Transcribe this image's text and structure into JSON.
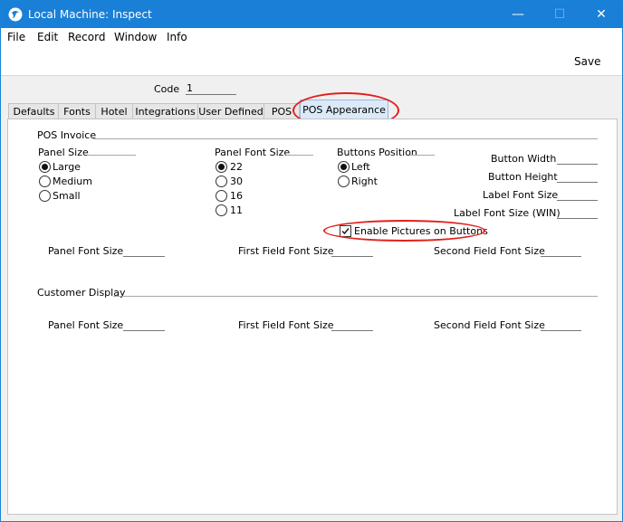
{
  "window": {
    "title": "Local Machine: Inspect",
    "minimize": "—",
    "maximize": "☐",
    "close": "✕"
  },
  "menu": [
    "File",
    "Edit",
    "Record",
    "Window",
    "Info"
  ],
  "toolbar": {
    "save_label": "Save"
  },
  "header": {
    "code_label": "Code",
    "code_value": "1"
  },
  "tabs": [
    "Defaults",
    "Fonts",
    "Hotel",
    "Integrations",
    "User Defined",
    "POS",
    "POS Appearance"
  ],
  "active_tab": "POS Appearance",
  "pos_invoice": {
    "title": "POS Invoice",
    "panel_size": {
      "label": "Panel Size",
      "options": [
        "Large",
        "Medium",
        "Small"
      ],
      "selected": "Large"
    },
    "panel_font_size": {
      "label": "Panel Font Size",
      "options": [
        "22",
        "30",
        "16",
        "11"
      ],
      "selected": "22"
    },
    "buttons_position": {
      "label": "Buttons Position",
      "options": [
        "Left",
        "Right"
      ],
      "selected": "Left"
    },
    "button_width": {
      "label": "Button Width",
      "value": ""
    },
    "button_height": {
      "label": "Button Height",
      "value": ""
    },
    "label_font_size": {
      "label": "Label Font Size",
      "value": ""
    },
    "label_font_size_win": {
      "label": "Label Font Size (WIN)",
      "value": ""
    },
    "enable_pictures": {
      "label": "Enable Pictures on Buttons",
      "checked": true
    },
    "panel_font_size_field": {
      "label": "Panel Font Size",
      "value": ""
    },
    "first_field_font_size": {
      "label": "First Field Font Size",
      "value": ""
    },
    "second_field_font_size": {
      "label": "Second Field Font Size",
      "value": ""
    }
  },
  "customer_display": {
    "title": "Customer Display",
    "panel_font_size": {
      "label": "Panel Font Size",
      "value": ""
    },
    "first_field_font_size": {
      "label": "First Field Font Size",
      "value": ""
    },
    "second_field_font_size": {
      "label": "Second Field Font Size",
      "value": ""
    }
  },
  "colors": {
    "titlebar": "#1a7fd6",
    "annotation": "#e0201c",
    "active_tab": "#dbe9f9"
  }
}
